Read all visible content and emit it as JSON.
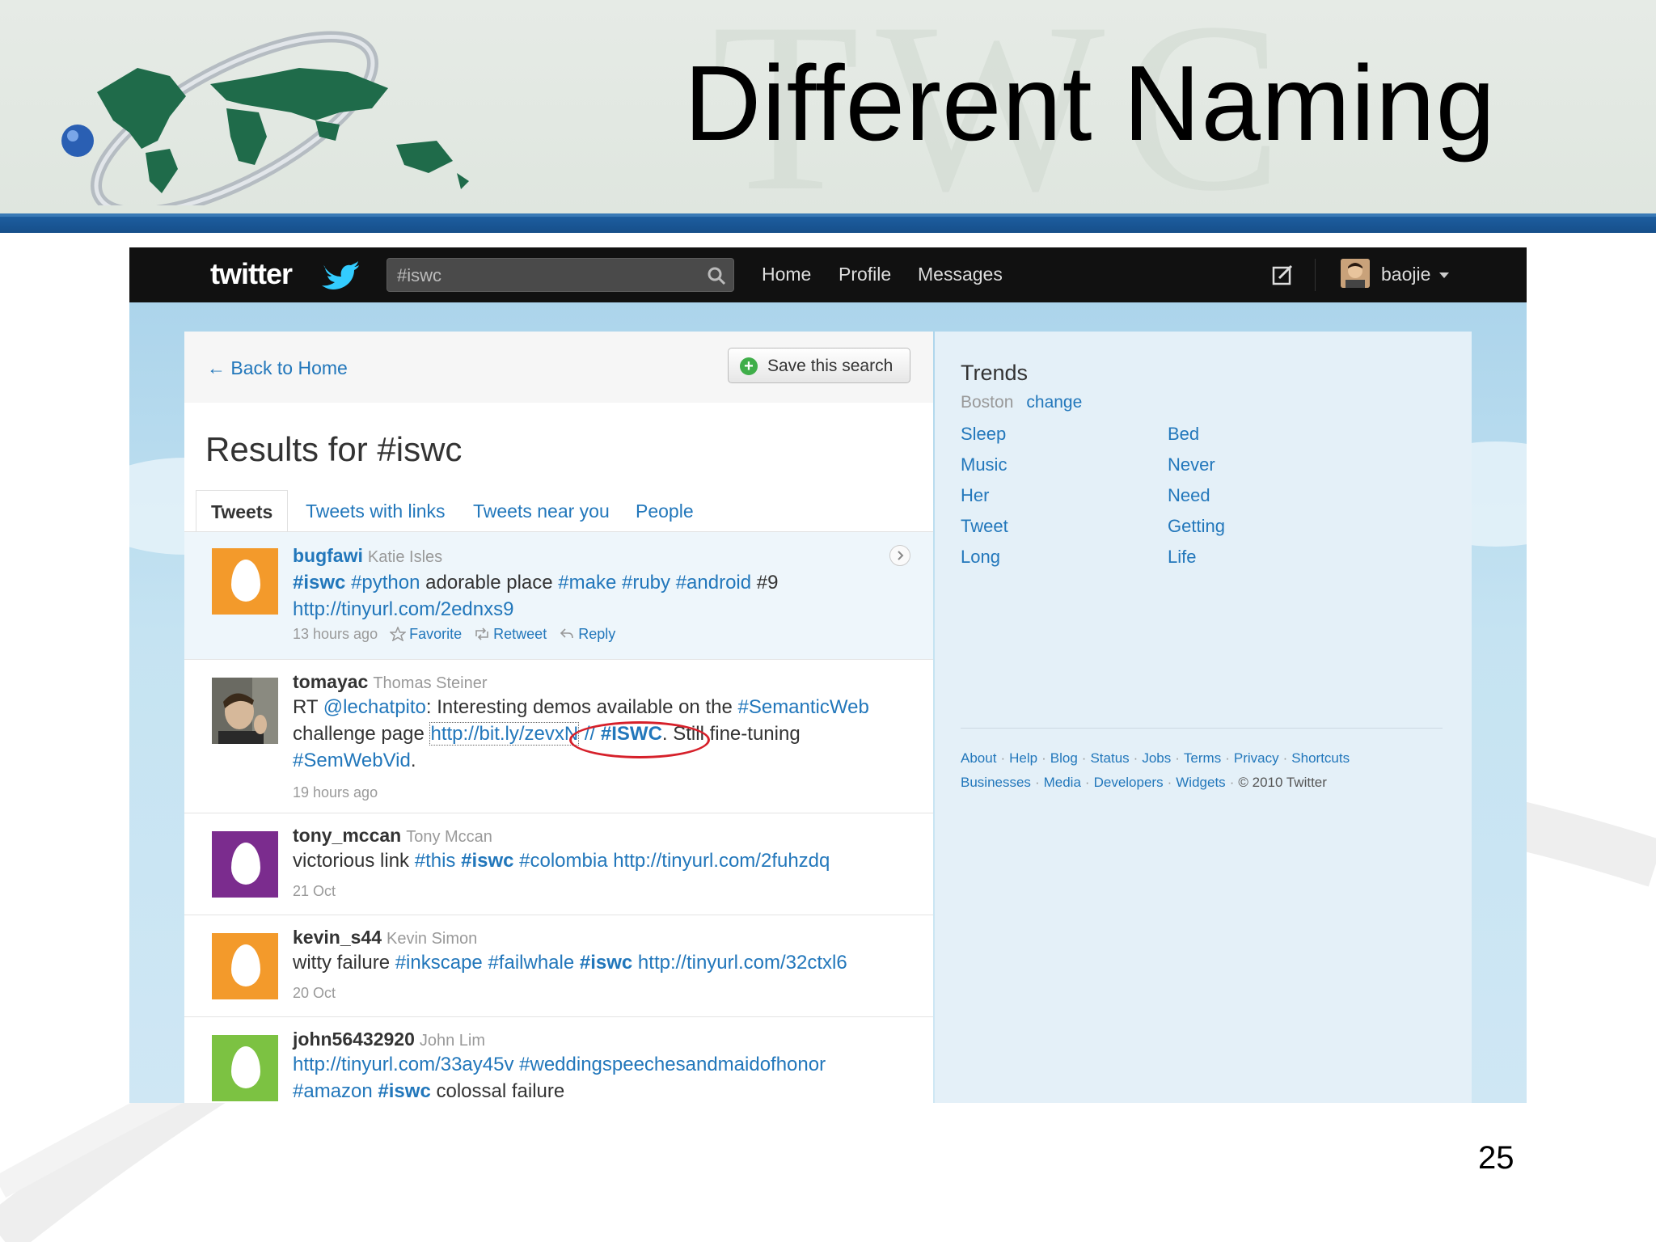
{
  "slide": {
    "title": "Different Naming",
    "watermark": "TWC",
    "page_number": "25"
  },
  "topbar": {
    "logo_text": "twitter",
    "search_value": "#iswc",
    "nav": [
      "Home",
      "Profile",
      "Messages"
    ],
    "user_name": "baojie"
  },
  "main": {
    "back_link": "← Back to Home",
    "save_search": "Save this search",
    "results_title": "Results for #iswc",
    "tabs": [
      "Tweets",
      "Tweets with links",
      "Tweets near you",
      "People"
    ],
    "tweets": [
      {
        "user": "bugfawi",
        "full_name": "Katie Isles",
        "text_parts": [
          "#iswc",
          " ",
          "#python",
          " adorable place ",
          "#make",
          " ",
          "#ruby",
          " ",
          "#android",
          " #9"
        ],
        "link": "http://tinyurl.com/2ednxs9",
        "time": "13 hours ago",
        "actions": [
          "Favorite",
          "Retweet",
          "Reply"
        ],
        "avatar_color": "#f39a2b"
      },
      {
        "user": "tomayac",
        "full_name": "Thomas Steiner",
        "line1_a": "RT ",
        "line1_mention": "@lechatpito",
        "line1_b": ": Interesting demos available on the ",
        "line1_tag": "#SemanticWeb",
        "line2_a": "challenge page ",
        "line2_link": "http://bit.ly/zevxN",
        "line2_b": " // ",
        "line2_tag": "#ISWC",
        "line2_c": ". Still fine-tuning",
        "line3_tag": "#SemWebVid",
        "line3_end": ".",
        "time": "19 hours ago"
      },
      {
        "user": "tony_mccan",
        "full_name": "Tony Mccan",
        "text_parts": [
          "victorious link ",
          "#this",
          " ",
          "#iswc",
          " ",
          "#colombia",
          " ",
          "http://tinyurl.com/2fuhzdq"
        ],
        "time": "21 Oct",
        "avatar_color": "#7b2c8e"
      },
      {
        "user": "kevin_s44",
        "full_name": "Kevin Simon",
        "text_parts": [
          "witty failure ",
          "#inkscape",
          " ",
          "#failwhale",
          " ",
          "#iswc",
          " ",
          "http://tinyurl.com/32ctxl6"
        ],
        "time": "20 Oct",
        "avatar_color": "#f39a2b"
      },
      {
        "user": "john56432920",
        "full_name": "John Lim",
        "line1_parts": [
          "http://tinyurl.com/33ay45v",
          " ",
          "#weddingspeechesandmaidofhonor"
        ],
        "line2_parts": [
          "#amazon",
          " ",
          "#iswc",
          " colossal failure"
        ],
        "avatar_color": "#7cc242"
      }
    ]
  },
  "sidebar": {
    "trends_title": "Trends",
    "location": "Boston",
    "change": "change",
    "trends_left": [
      "Sleep",
      "Music",
      "Her",
      "Tweet",
      "Long"
    ],
    "trends_right": [
      "Bed",
      "Never",
      "Need",
      "Getting",
      "Life"
    ],
    "footer_row1": [
      "About",
      "Help",
      "Blog",
      "Status",
      "Jobs",
      "Terms",
      "Privacy",
      "Shortcuts"
    ],
    "footer_row2": [
      "Businesses",
      "Media",
      "Developers",
      "Widgets"
    ],
    "copyright": "© 2010 Twitter"
  }
}
